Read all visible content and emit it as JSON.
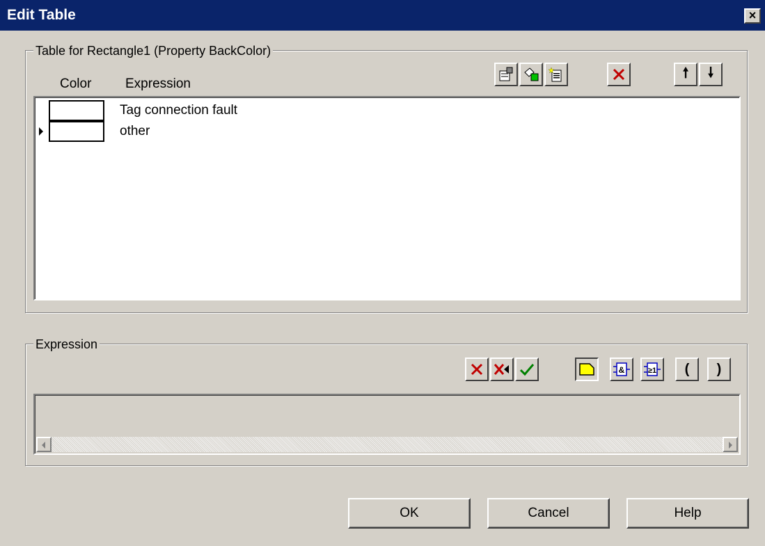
{
  "window": {
    "title": "Edit Table",
    "close_label": "×"
  },
  "table_group": {
    "legend": "Table for Rectangle1 (Property BackColor)",
    "columns": {
      "color": "Color",
      "expression": "Expression"
    },
    "rows": [
      {
        "color": "#ffffff",
        "expression": "Tag connection fault",
        "selected": false
      },
      {
        "color": "#ffffff",
        "expression": "other",
        "selected": true
      }
    ],
    "toolbar": {
      "properties_icon": "properties-icon",
      "paint_icon": "paint-icon",
      "new_icon": "new-document-icon",
      "delete_icon": "delete-icon",
      "up_label": "🠕",
      "down_label": "🠗"
    }
  },
  "expression_group": {
    "legend": "Expression",
    "value": "",
    "toolbar": {
      "delete_label": "✕",
      "delete_all_label": "✕◂",
      "apply_label": "✓",
      "and_label": "&",
      "or_label": "≥1",
      "open_paren_label": "(",
      "close_paren_label": ")"
    }
  },
  "buttons": {
    "ok": "OK",
    "cancel": "Cancel",
    "help": "Help"
  },
  "colors": {
    "titlebar": "#0a246a",
    "dialog_bg": "#d4d0c8",
    "delete_red": "#c00000",
    "check_green": "#008000",
    "operand_yellow": "#ffff00"
  }
}
